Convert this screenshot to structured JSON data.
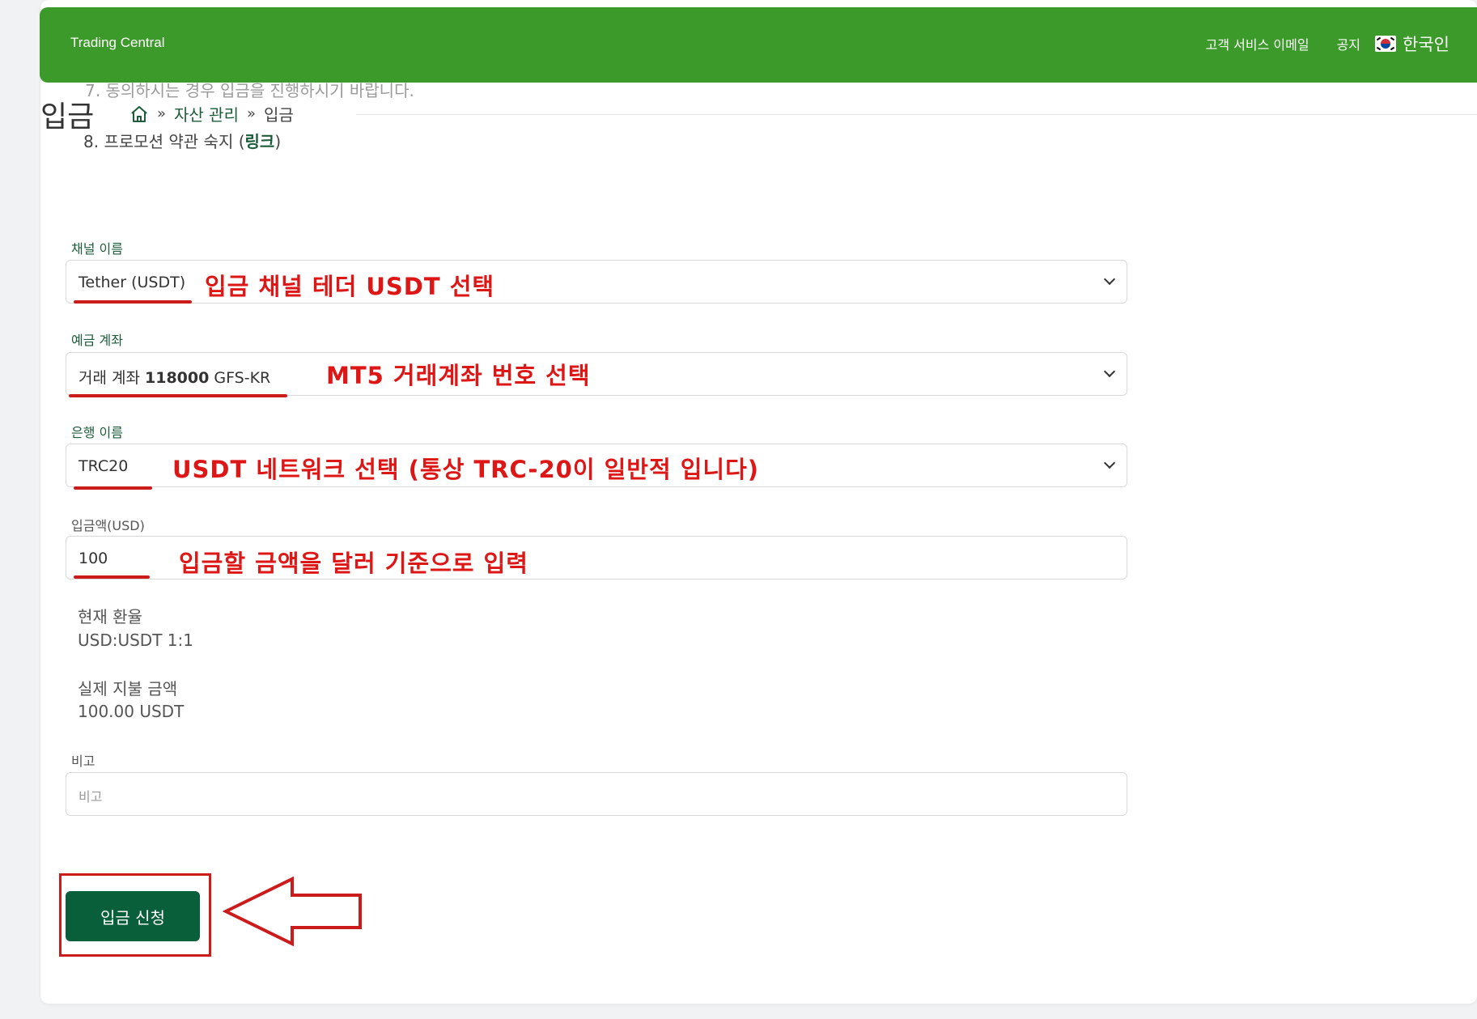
{
  "header": {
    "brand": "Trading Central",
    "nav": [
      "고객 서비스 이메일",
      "공지"
    ],
    "language": "한국인"
  },
  "notice_behind": "7. 동의하시는 경우 입금을 진행하시기 바랍니다.",
  "page": {
    "title": "입금",
    "breadcrumb": [
      "자산 관리",
      "입금"
    ],
    "separator": "»"
  },
  "notice": {
    "prefix": "8. 프로모션 약관 숙지 (",
    "link": "링크",
    "suffix": ")"
  },
  "form": {
    "channel": {
      "label": "채널 이름",
      "value": "Tether (USDT)"
    },
    "account": {
      "label": "예금 계좌",
      "prefix": "거래 계좌 ",
      "number": "118000",
      "suffix": " GFS-KR"
    },
    "bank": {
      "label": "은행 이름",
      "value": "TRC20"
    },
    "amount": {
      "label": "입금액(USD)",
      "value": "100"
    },
    "rate": {
      "label": "현재 환율",
      "value": "USD:USDT 1:1"
    },
    "actual": {
      "label": "실제 지불 금액",
      "value": "100.00 USDT"
    },
    "remark": {
      "label": "비고",
      "placeholder": "비고"
    },
    "submit_label": "입금 신청"
  },
  "annotations": {
    "channel": "입금 채널 테더 USDT 선택",
    "account": "MT5 거래계좌 번호 선택",
    "bank": "USDT 네트워크 선택 (통상 TRC-20이 일반적 입니다)",
    "amount": "입금할 금액을 달러 기준으로 입력",
    "color": "#dd1616"
  },
  "colors": {
    "header_green": "#3b9a2a",
    "button_green": "#0a5f3b",
    "label_green": "#1d5c3a"
  }
}
